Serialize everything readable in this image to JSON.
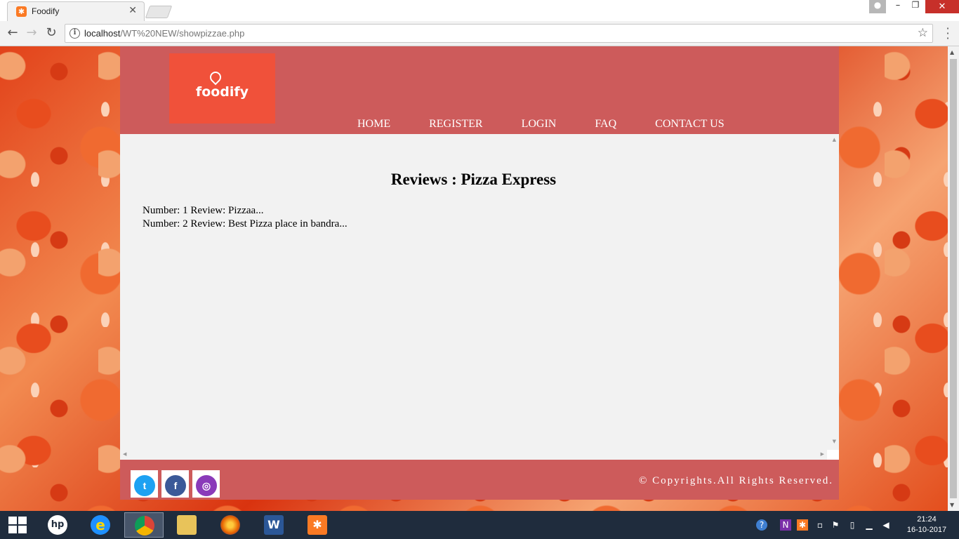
{
  "browser": {
    "tab_title": "Foodify",
    "tab_favicon": "xampp-icon",
    "url_host": "localhost",
    "url_path": "/WT%20NEW/showpizzae.php"
  },
  "site": {
    "logo_text": "foodify",
    "nav": [
      "HOME",
      "REGISTER",
      "LOGIN",
      "FAQ",
      "CONTACT US"
    ],
    "heading": "Reviews : Pizza Express",
    "reviews": [
      "Number: 1 Review: Pizzaa...",
      "Number: 2 Review: Best Pizza place in bandra..."
    ],
    "social": [
      {
        "name": "twitter",
        "glyph": "t",
        "color": "#1da1f2"
      },
      {
        "name": "facebook",
        "glyph": "f",
        "color": "#3b5998"
      },
      {
        "name": "instagram",
        "glyph": "◎",
        "color": "#8a3ab9"
      }
    ],
    "copyright": "©  Copyrights.All Rights Reserved.",
    "colors": {
      "header": "#cd5b5b",
      "logo_bg": "#f0513a",
      "content_bg": "#f2f2f2"
    }
  },
  "taskbar": {
    "time": "21:24",
    "date": "16-10-2017",
    "apps": [
      "hp",
      "internet-explorer",
      "chrome",
      "file-explorer",
      "firefox",
      "word",
      "xampp"
    ]
  }
}
